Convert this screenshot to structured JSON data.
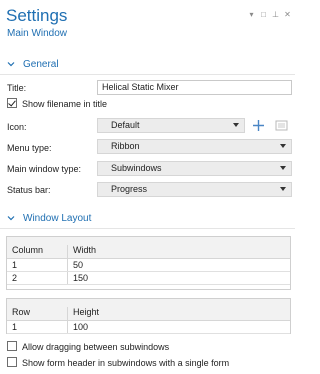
{
  "window": {
    "title": "Settings",
    "subtitle": "Main Window",
    "controls": [
      "▾",
      "□",
      "⊥",
      "✕"
    ]
  },
  "general": {
    "header": "General",
    "title_label": "Title:",
    "title_value": "Helical Static Mixer",
    "show_filename_label": "Show filename in title",
    "show_filename_checked": true,
    "icon_label": "Icon:",
    "icon_value": "Default",
    "menu_type_label": "Menu type:",
    "menu_type_value": "Ribbon",
    "main_window_type_label": "Main window type:",
    "main_window_type_value": "Subwindows",
    "status_bar_label": "Status bar:",
    "status_bar_value": "Progress"
  },
  "layout": {
    "header": "Window Layout",
    "columns_table": {
      "headers": [
        "Column",
        "Width"
      ],
      "rows": [
        [
          "1",
          "50"
        ],
        [
          "2",
          "150"
        ]
      ]
    },
    "rows_table": {
      "headers": [
        "Row",
        "Height"
      ],
      "rows": [
        [
          "1",
          "100"
        ]
      ]
    },
    "allow_dragging_label": "Allow dragging between subwindows",
    "allow_dragging_checked": false,
    "show_form_header_label": "Show form header in subwindows with a single form",
    "show_form_header_checked": false
  },
  "colors": {
    "accent": "#1f6fb2",
    "combo_bg": "#ececec"
  }
}
